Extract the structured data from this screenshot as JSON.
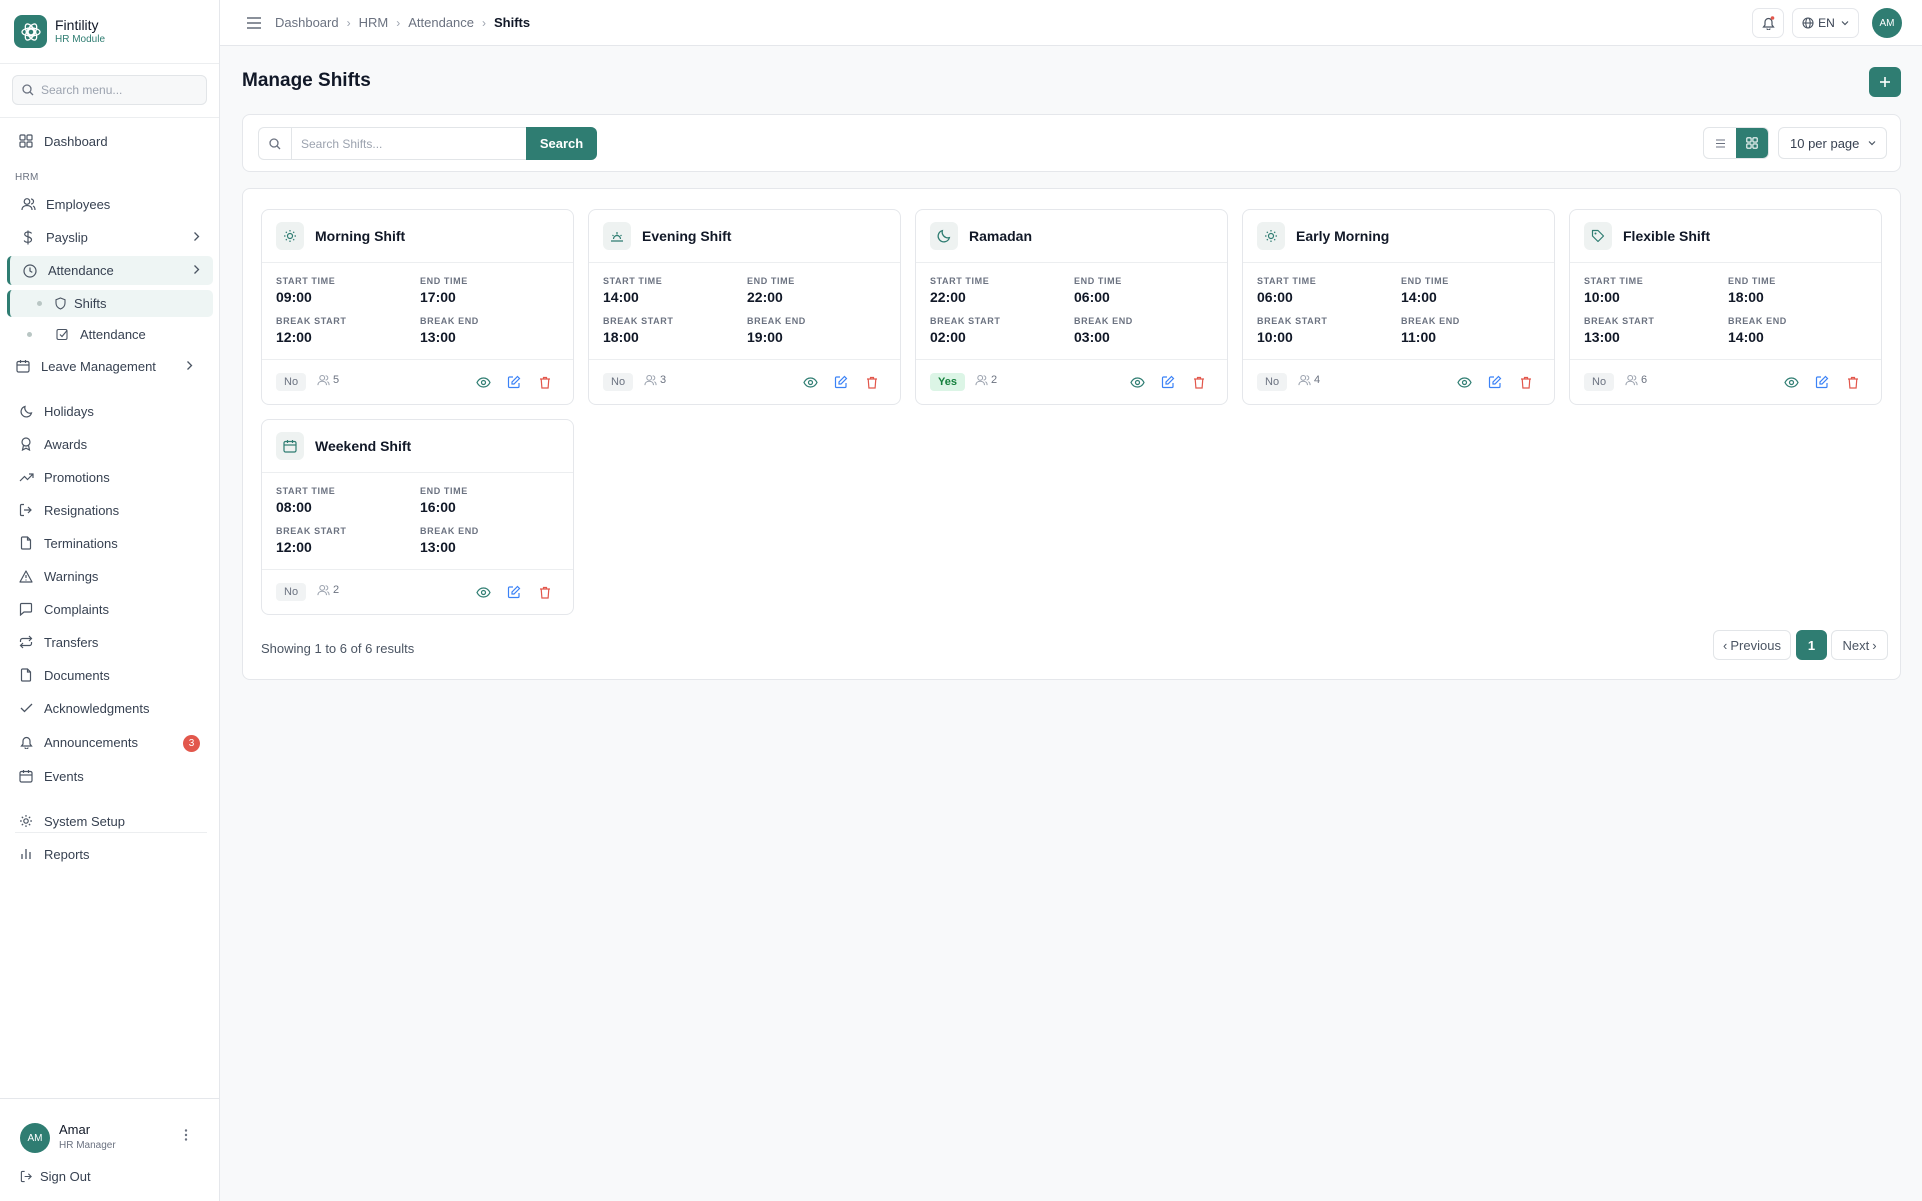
{
  "brand": {
    "name": "Fintility",
    "subtitle": "HR Module"
  },
  "sidebar": {
    "search_placeholder": "Search menu...",
    "dashboard": "Dashboard",
    "section_label": "HRM",
    "items": {
      "employees": "Employees",
      "payslip": "Payslip",
      "attendance": "Attendance",
      "shifts": "Shifts",
      "attendance_sub": "Attendance",
      "leave": "Leave Management",
      "holidays": "Holidays",
      "awards": "Awards",
      "promotions": "Promotions",
      "resignations": "Resignations",
      "terminations": "Terminations",
      "warnings": "Warnings",
      "complaints": "Complaints",
      "transfers": "Transfers",
      "documents": "Documents",
      "acknowledgments": "Acknowledgments",
      "announcements": "Announcements",
      "announcements_badge": "3",
      "events": "Events",
      "system_setup": "System Setup",
      "reports": "Reports"
    },
    "user": {
      "initials": "AM",
      "name": "Amar",
      "role": "HR Manager"
    },
    "sign_out": "Sign Out"
  },
  "topbar": {
    "breadcrumb": [
      "Dashboard",
      "HRM",
      "Attendance",
      "Shifts"
    ],
    "language": "EN",
    "avatar_initials": "AM"
  },
  "main": {
    "title": "Manage Shifts",
    "search_placeholder": "Search Shifts...",
    "search_button": "Search",
    "per_page": "10 per page",
    "labels": {
      "start": "START TIME",
      "end": "END TIME",
      "break_start": "BREAK START",
      "break_end": "BREAK END"
    },
    "shifts": [
      {
        "name": "Morning Shift",
        "icon": "sun-icon",
        "start": "09:00",
        "end": "17:00",
        "break_start": "12:00",
        "break_end": "13:00",
        "night": "No",
        "employees": "5"
      },
      {
        "name": "Evening Shift",
        "icon": "sunset-icon",
        "start": "14:00",
        "end": "22:00",
        "break_start": "18:00",
        "break_end": "19:00",
        "night": "No",
        "employees": "3"
      },
      {
        "name": "Ramadan",
        "icon": "moon-icon",
        "start": "22:00",
        "end": "06:00",
        "break_start": "02:00",
        "break_end": "03:00",
        "night": "Yes",
        "employees": "2"
      },
      {
        "name": "Early Morning",
        "icon": "sun-icon",
        "start": "06:00",
        "end": "14:00",
        "break_start": "10:00",
        "break_end": "11:00",
        "night": "No",
        "employees": "4"
      },
      {
        "name": "Flexible Shift",
        "icon": "tag-icon",
        "start": "10:00",
        "end": "18:00",
        "break_start": "13:00",
        "break_end": "14:00",
        "night": "No",
        "employees": "6"
      },
      {
        "name": "Weekend Shift",
        "icon": "calendar-icon",
        "start": "08:00",
        "end": "16:00",
        "break_start": "12:00",
        "break_end": "13:00",
        "night": "No",
        "employees": "2"
      }
    ],
    "showing": "Showing 1 to 6 of 6 results",
    "pagination": {
      "previous": "Previous",
      "current": "1",
      "next": "Next"
    }
  },
  "colors": {
    "accent": "#2f7d72",
    "danger": "#e2574c",
    "edit": "#3b82f6"
  }
}
